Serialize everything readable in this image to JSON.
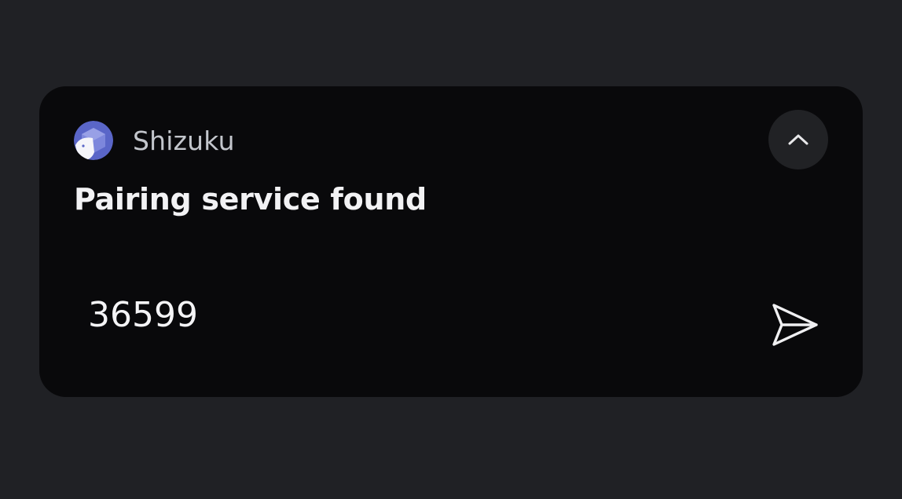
{
  "notification": {
    "app_name": "Shizuku",
    "title": "Pairing service found",
    "reply_value": "36599",
    "icons": {
      "app": "shizuku-app-icon",
      "collapse": "chevron-up-icon",
      "send": "send-icon"
    }
  },
  "colors": {
    "background": "#202125",
    "card": "#09090b",
    "collapse_button": "#212225",
    "app_icon_blue": "#5a66c8",
    "text_primary": "#f2f2f4",
    "text_secondary": "#c3c6cc"
  }
}
